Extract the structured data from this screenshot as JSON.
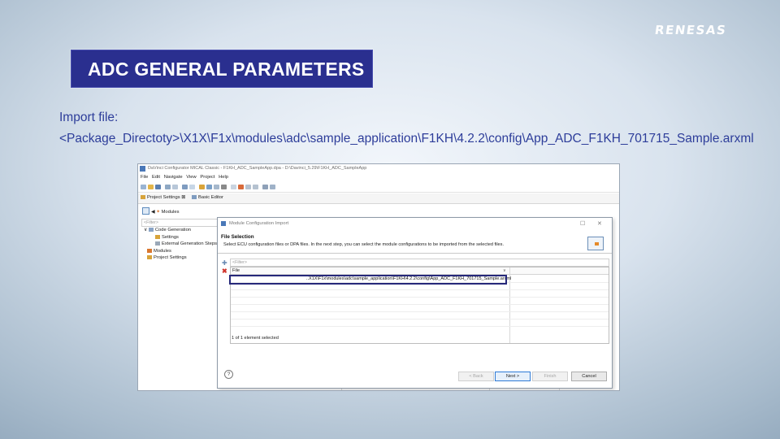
{
  "slide": {
    "brand": "RENESAS",
    "title": "ADC GENERAL PARAMETERS",
    "import_label": "Import file:",
    "import_path": "<Package_Directoty>\\X1X\\F1x\\modules\\adc\\sample_application\\F1KH\\4.2.2\\config\\App_ADC_F1KH_701715_Sample.arxml"
  },
  "ide": {
    "window_title": "DaVinci Configurator MICAL Classic - F1KH_ADC_SampleApp.dpa - D:\\Davinci_5.29\\F1KH_ADC_SampleApp",
    "menu": [
      "File",
      "Edit",
      "Navigate",
      "View",
      "Project",
      "Help"
    ],
    "tabs": [
      "Project Settings",
      "Basic Editor"
    ],
    "breadcrumb": "Modules",
    "tree_filter": "<Filter>",
    "tree": [
      "Code Generation",
      "Settings",
      "External Generation Steps",
      "Modules",
      "Project Settings"
    ]
  },
  "dialog": {
    "title": "Module Configuration Import",
    "section_title": "File Selection",
    "section_desc": "Select ECU configuration files or DPA files. In the next step, you can select the module configurations to be imported from the selected files.",
    "filter_placeholder": "<Filter>",
    "column_file": "File",
    "file_row": "..X1X\\F1x\\modules\\adc\\sample_application\\F1KH\\4.2.2\\config\\App_ADC_F1KH_701715_Sample.arxml",
    "status": "1 of 1 element selected",
    "buttons": {
      "back": "< Back",
      "next": "Next >",
      "finish": "Finish",
      "cancel": "Cancel"
    }
  },
  "colors": {
    "title_bg": "#2a2f8f",
    "text_blue": "#2d3d9a",
    "highlight": "#26287a"
  }
}
